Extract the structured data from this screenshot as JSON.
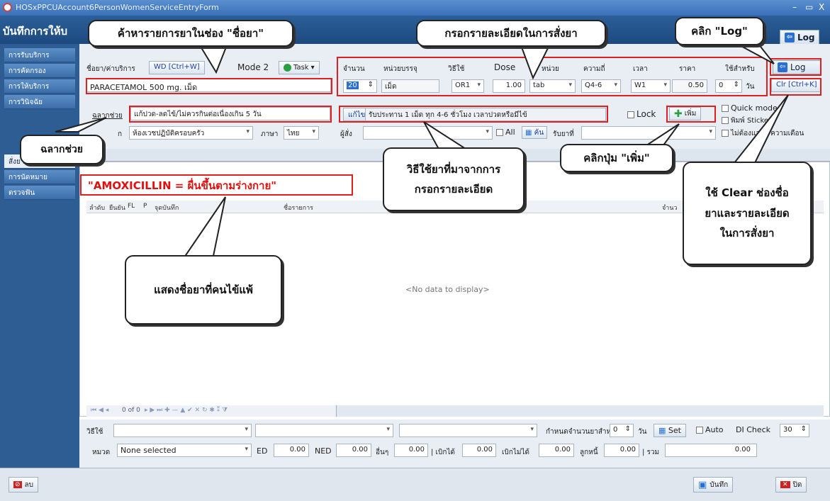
{
  "window": {
    "title": "HOSxPPCUAccount6PersonWomenServiceEntryForm",
    "minimize": "–",
    "restore": "▭",
    "close": "X"
  },
  "app_title": "บันทึกการให้บ",
  "log_button_header": "Log",
  "sidebar": {
    "items": [
      "การรับบริการ",
      "การคัดกรอง",
      "การให้บริการ",
      "การวินิจฉัย",
      "สั่งยา",
      "การนัดหมาย",
      "ตรวจฟัน"
    ]
  },
  "form": {
    "drug_label": "ชื่อยา/ค่าบริการ",
    "wd_button": "WD [Ctrl+W]",
    "mode2": "Mode 2",
    "task_button": "Task",
    "drug_value": "PARACETAMOL 500 mg. เม็ด",
    "headers": {
      "qty": "จำนวน",
      "unit": "หน่วยบรรจุ",
      "usage": "วิธีใช้",
      "dose": "Dose",
      "dose_unit": "หน่วย",
      "freq": "ความถี่",
      "time": "เวลา",
      "price": "ราคา",
      "use_for": "ใช้สำหรับ"
    },
    "values": {
      "qty": "20",
      "unit": "เม็ด",
      "usage": "OR1",
      "dose": "1.00",
      "dose_unit": "tab",
      "freq": "Q4-6",
      "time": "W1",
      "price": "0.50",
      "use_for": "0",
      "days": "วัน"
    },
    "log_button": "Log",
    "clr_button": "Clr [Ctrl+K]",
    "label_help": "ฉลากช่วย",
    "label_help_value": "แก้ปวด-ลดไข้/ไม่ควรกินต่อเนื่องเกิน 5 วัน",
    "edit_button": "แก้ไข",
    "usage_text": "รับประทาน 1 เม็ด ทุก 4-6 ชั่วโมง เวลาปวดหรือมีไข้",
    "lock": "Lock",
    "add_button": "เพิ่ม",
    "quick_mode": "Quick mode",
    "print_sticker": "พิมพ์ Sticke",
    "no_alert": "ไม่ต้องแสดง ความเตือน",
    "dept_label_partial": "ก",
    "dept_value": "ห้องเวชปฏิบัติครอบครัว",
    "lang_label": "ภาษา",
    "lang_value": "ไทย",
    "orderer_label": "ผู้สั่ง",
    "all_label": "All",
    "search_button": "ค้น",
    "drug_list_label": "รับยาที่"
  },
  "grid": {
    "headers": [
      "ลำดับ",
      "ยืนยัน",
      "FL",
      "P",
      "จุดบันทึก",
      "ชื่อรายการ",
      "จำนว"
    ],
    "empty": "<No data to display>",
    "nav_text": "0 of 0"
  },
  "allergy_text": "\"AMOXICILLIN = ผื่นขึ้นตามร่างกาย\"",
  "bottom": {
    "usage_label": "วิธีใช้",
    "days_for": "กำหนดจำนวนยาสำหรับ",
    "days_value": "0",
    "days_unit": "วัน",
    "set_button": "Set",
    "auto": "Auto",
    "di_check": "DI Check",
    "di_value": "30",
    "category_label": "หมวด",
    "category_value": "None selected",
    "ed_label": "ED",
    "ed_value": "0.00",
    "ned_label": "NED",
    "ned_value": "0.00",
    "other_label": "อื่นๆ",
    "other_value": "0.00",
    "claim_label": "| เบิกได้",
    "claim_value": "0.00",
    "noclaim_label": "เบิกไม่ได้",
    "noclaim_value": "0.00",
    "debtor_label": "ลูกหนี้",
    "debtor_value": "0.00",
    "total_label": "| รวม",
    "total_value": "0.00"
  },
  "footer": {
    "delete": "ลบ",
    "save": "บันทึก",
    "close": "ปิด"
  },
  "callouts": {
    "search_drug": "ค้าหารายการยาในช่อง \"ชื่อยา\"",
    "fill_details": "กรอกรายละเอียดในการสั่งยา",
    "click_log": "คลิก \"Log\"",
    "label_help": "ฉลากช่วย",
    "usage_from": "วิธีใช้ยาที่มาจากการ\nกรอกรายละเอียด",
    "click_add": "คลิกปุ่ม \"เพิ่ม\"",
    "use_clear": "ใช้ Clear ช่องชื่อ\nยาและรายละเอียด\nในการสั่งยา",
    "show_allergy": "แสดงชื่อยาที่คนไข้แพ้"
  }
}
